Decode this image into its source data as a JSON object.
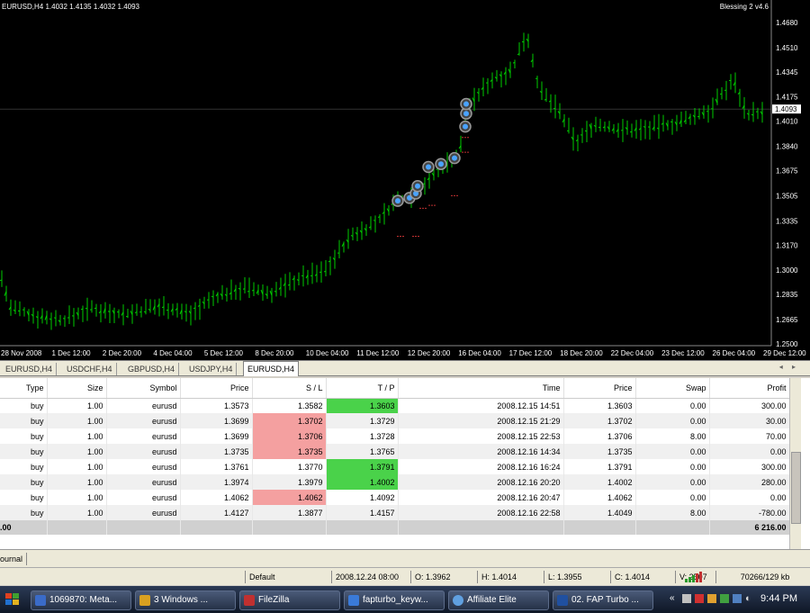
{
  "chart": {
    "header": "EURUSD,H4  1.4032 1.4135 1.4032 1.4093",
    "expert": "Blessing 2 v4.6",
    "expert_icon": "smiley-icon",
    "price_labels": [
      "1.4680",
      "1.4510",
      "1.4345",
      "1.4175",
      "1.4010",
      "1.3840",
      "1.3675",
      "1.3505",
      "1.3335",
      "1.3170",
      "1.3000",
      "1.2835",
      "1.2665",
      "1.2500"
    ],
    "current_price": "1.4093",
    "time_labels": [
      "28 Nov 2008",
      "1 Dec 12:00",
      "2 Dec 20:00",
      "4 Dec 04:00",
      "5 Dec 12:00",
      "8 Dec 20:00",
      "10 Dec 04:00",
      "11 Dec 12:00",
      "12 Dec 20:00",
      "16 Dec 04:00",
      "17 Dec 12:00",
      "18 Dec 20:00",
      "22 Dec 04:00",
      "23 Dec 12:00",
      "26 Dec 04:00",
      "29 Dec 12:00"
    ],
    "colors": {
      "bg": "#000000",
      "candle": "#00cc00",
      "grid": "#1a1a1a",
      "text": "#ffffff",
      "marker": "#4aa3ff"
    }
  },
  "tabs": [
    "EURUSD,H4",
    "USDCHF,H4",
    "GBPUSD,H4",
    "USDJPY,H4",
    "EURUSD,H4"
  ],
  "active_tab": 4,
  "tab_scroll": "◂ ▸",
  "trade": {
    "columns": [
      "Type",
      "Size",
      "Symbol",
      "Price",
      "S / L",
      "T / P",
      "Time",
      "Price",
      "Swap",
      "Profit"
    ],
    "rows": [
      [
        "buy",
        "1.00",
        "eurusd",
        "1.3573",
        "1.3582",
        "1.3603",
        "2008.12.15 14:51",
        "1.3603",
        "0.00",
        "300.00"
      ],
      [
        "buy",
        "1.00",
        "eurusd",
        "1.3699",
        "1.3702",
        "1.3729",
        "2008.12.15 21:29",
        "1.3702",
        "0.00",
        "30.00"
      ],
      [
        "buy",
        "1.00",
        "eurusd",
        "1.3699",
        "1.3706",
        "1.3728",
        "2008.12.15 22:53",
        "1.3706",
        "8.00",
        "70.00"
      ],
      [
        "buy",
        "1.00",
        "eurusd",
        "1.3735",
        "1.3735",
        "1.3765",
        "2008.12.16 14:34",
        "1.3735",
        "0.00",
        "0.00"
      ],
      [
        "buy",
        "1.00",
        "eurusd",
        "1.3761",
        "1.3770",
        "1.3791",
        "2008.12.16 16:24",
        "1.3791",
        "0.00",
        "300.00"
      ],
      [
        "buy",
        "1.00",
        "eurusd",
        "1.3974",
        "1.3979",
        "1.4002",
        "2008.12.16 20:20",
        "1.4002",
        "0.00",
        "280.00"
      ],
      [
        "buy",
        "1.00",
        "eurusd",
        "1.4062",
        "1.4062",
        "1.4092",
        "2008.12.16 20:47",
        "1.4062",
        "0.00",
        "0.00"
      ],
      [
        "buy",
        "1.00",
        "eurusd",
        "1.4127",
        "1.3877",
        "1.4157",
        "2008.12.16 22:58",
        "1.4049",
        "8.00",
        "-780.00"
      ]
    ],
    "highlight": [
      {
        "sl": "",
        "tp": "green"
      },
      {
        "sl": "red",
        "tp": ""
      },
      {
        "sl": "red",
        "tp": ""
      },
      {
        "sl": "red",
        "tp": ""
      },
      {
        "sl": "",
        "tp": "green"
      },
      {
        "sl": "",
        "tp": "green"
      },
      {
        "sl": "red",
        "tp": ""
      },
      {
        "sl": "",
        "tp": ""
      }
    ],
    "total_left": ".00",
    "total_profit": "6 216.00"
  },
  "journal_tab": "ournal",
  "status": {
    "profile": "Default",
    "datetime": "2008.12.24 08:00",
    "open": "O: 1.3962",
    "high": "H: 1.4014",
    "low": "L: 1.3955",
    "close": "C: 1.4014",
    "volume": "V: 2507",
    "traffic": "70266/129 kb"
  },
  "taskbar": {
    "items": [
      {
        "label": "1069870: Meta...",
        "color": "#3a6bc8"
      },
      {
        "label": "3 Windows ...",
        "color": "#d8a020"
      },
      {
        "label": "FileZilla",
        "color": "#c03030"
      },
      {
        "label": "fapturbo_keyw...",
        "color": "#3a7ad8"
      },
      {
        "label": "Affiliate Elite",
        "color": "#60a0e0"
      },
      {
        "label": "02. FAP Turbo ...",
        "color": "#2050a0"
      }
    ],
    "clock": "9:44 PM"
  }
}
